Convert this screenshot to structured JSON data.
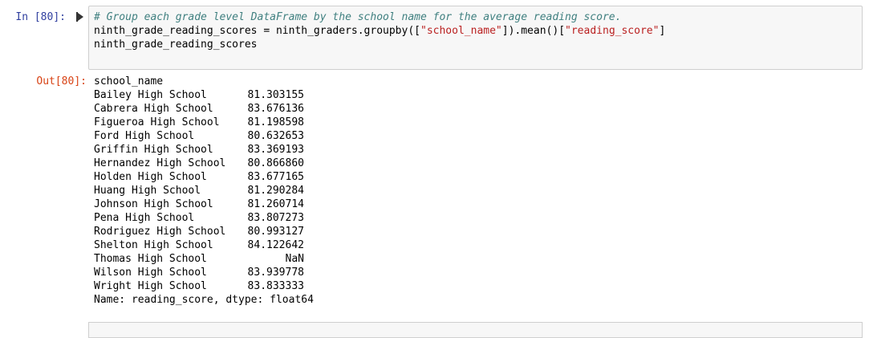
{
  "cell": {
    "in_prompt": "In [80]:",
    "out_prompt": "Out[80]:",
    "code": {
      "comment": "# Group each grade level DataFrame by the school name for the average reading score.",
      "line2_pre": "ninth_grade_reading_scores = ninth_graders.groupby([",
      "line2_str1": "\"school_name\"",
      "line2_mid": "]).mean()[",
      "line2_str2": "\"reading_score\"",
      "line2_post": "]",
      "line3": "ninth_grade_reading_scores"
    },
    "output": {
      "index_header": "school_name",
      "rows": [
        {
          "name": "Bailey High School",
          "value": "81.303155"
        },
        {
          "name": "Cabrera High School",
          "value": "83.676136"
        },
        {
          "name": "Figueroa High School",
          "value": "81.198598"
        },
        {
          "name": "Ford High School",
          "value": "80.632653"
        },
        {
          "name": "Griffin High School",
          "value": "83.369193"
        },
        {
          "name": "Hernandez High School",
          "value": "80.866860"
        },
        {
          "name": "Holden High School",
          "value": "83.677165"
        },
        {
          "name": "Huang High School",
          "value": "81.290284"
        },
        {
          "name": "Johnson High School",
          "value": "81.260714"
        },
        {
          "name": "Pena High School",
          "value": "83.807273"
        },
        {
          "name": "Rodriguez High School",
          "value": "80.993127"
        },
        {
          "name": "Shelton High School",
          "value": "84.122642"
        },
        {
          "name": "Thomas High School",
          "value": "NaN"
        },
        {
          "name": "Wilson High School",
          "value": "83.939778"
        },
        {
          "name": "Wright High School",
          "value": "83.833333"
        }
      ],
      "footer": "Name: reading_score, dtype: float64"
    }
  },
  "colors": {
    "in_prompt": "#303f9f",
    "out_prompt": "#d84315",
    "comment": "#408080",
    "string": "#ba2121",
    "input_bg": "#f7f7f7",
    "input_border": "#cfcfcf"
  },
  "icons": {
    "run": "run-cell-icon"
  }
}
